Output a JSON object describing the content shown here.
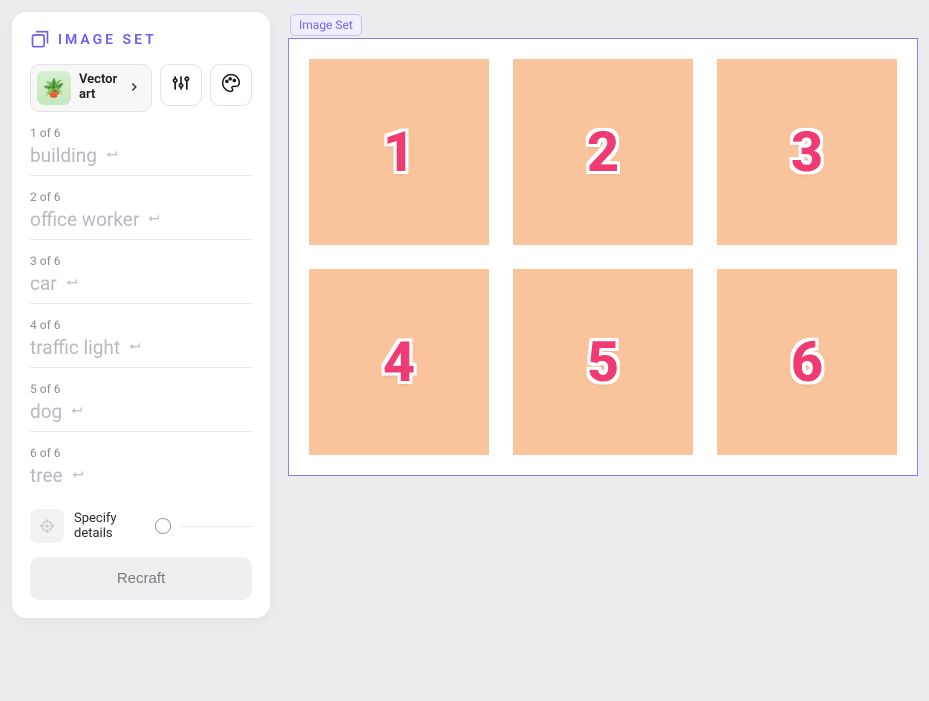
{
  "header": {
    "title": "IMAGE SET"
  },
  "style": {
    "label": "Vector art"
  },
  "prompts": [
    {
      "index": "1 of 6",
      "text": "building"
    },
    {
      "index": "2 of 6",
      "text": "office worker"
    },
    {
      "index": "3 of 6",
      "text": "car"
    },
    {
      "index": "4 of 6",
      "text": "traffic light"
    },
    {
      "index": "5 of 6",
      "text": "dog"
    },
    {
      "index": "6 of 6",
      "text": "tree"
    }
  ],
  "details": {
    "label": "Specify details"
  },
  "recraft": {
    "label": "Recraft"
  },
  "canvas": {
    "tag": "Image Set",
    "tiles": [
      "1",
      "2",
      "3",
      "4",
      "5",
      "6"
    ]
  }
}
